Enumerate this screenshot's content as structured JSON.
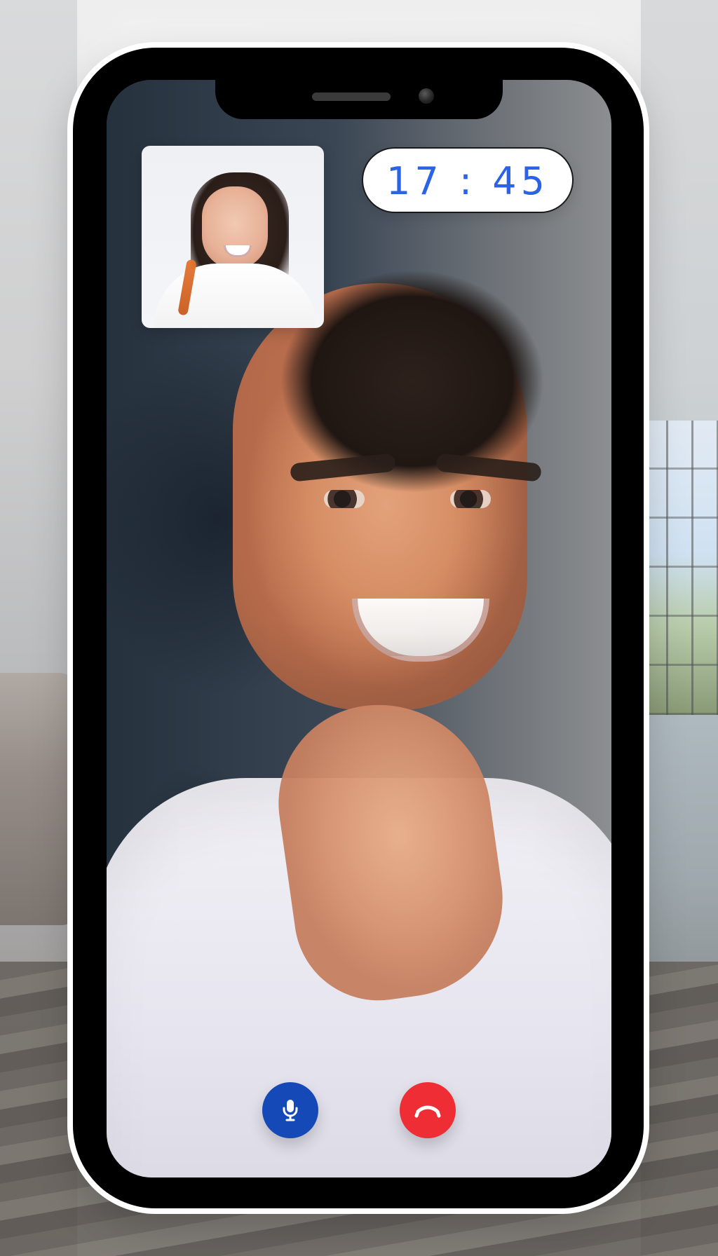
{
  "call": {
    "timer": "17 : 45"
  },
  "controls": {
    "mic_icon": "mic-icon",
    "end_icon": "end-call-icon"
  },
  "colors": {
    "timer_text": "#2A62E8",
    "mic_button": "#1649B8",
    "end_button": "#EF2D34"
  }
}
